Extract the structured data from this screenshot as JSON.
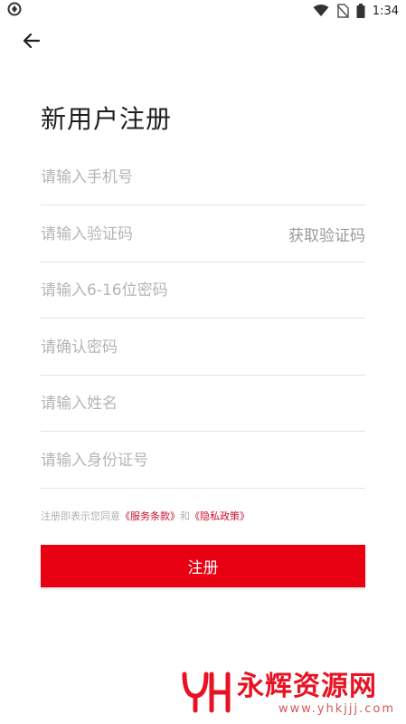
{
  "status": {
    "time": "1:34",
    "icons": [
      "app-indicator-icon",
      "wifi-icon",
      "no-sim-icon",
      "battery-icon"
    ]
  },
  "header": {
    "back_icon": "arrow-left-icon"
  },
  "page": {
    "title": "新用户注册"
  },
  "form": {
    "phone_placeholder": "请输入手机号",
    "code_placeholder": "请输入验证码",
    "get_code_label": "获取验证码",
    "password_placeholder": "请输入6-16位密码",
    "confirm_placeholder": "请确认密码",
    "name_placeholder": "请输入姓名",
    "idcard_placeholder": "请输入身份证号"
  },
  "agreement": {
    "prefix": "注册即表示您同意",
    "terms": "《服务条款》",
    "and": "和",
    "privacy": "《隐私政策》"
  },
  "actions": {
    "register_label": "注册"
  },
  "watermark": {
    "main": "永辉资源网",
    "sub": "www.yhkjjj.com"
  },
  "colors": {
    "accent": "#e60012",
    "link": "#c8102e",
    "placeholder": "#b5b5b5"
  }
}
